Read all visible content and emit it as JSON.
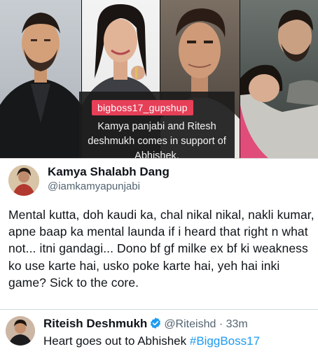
{
  "collage": {
    "tag": "bigboss17_gupshup",
    "caption": "Kamya panjabi and Ritesh deshmukh comes in support of Abhishek."
  },
  "tweet1": {
    "name": "Kamya Shalabh Dang",
    "handle": "@iamkamyapunjabi",
    "body": "Mental kutta, doh kaudi ka, chal nikal nikal, nakli kumar, apne baap ka mental launda if i heard that right n what not... itni gandagi... Dono bf gf milke ex bf ki weakness ko use karte hai, usko poke karte hai, yeh hai inki game? Sick to the core."
  },
  "tweet2": {
    "name": "Riteish Deshmukh",
    "handle": "@Riteishd",
    "separator": "·",
    "time": "33m",
    "body_text": "Heart goes out to Abhishek ",
    "hashtag": "#BiggBoss17"
  },
  "colors": {
    "tag_bg": "#e63f58",
    "verified_blue": "#1d9bf0",
    "hashtag": "#1d9bf0",
    "muted_text": "#536471"
  }
}
